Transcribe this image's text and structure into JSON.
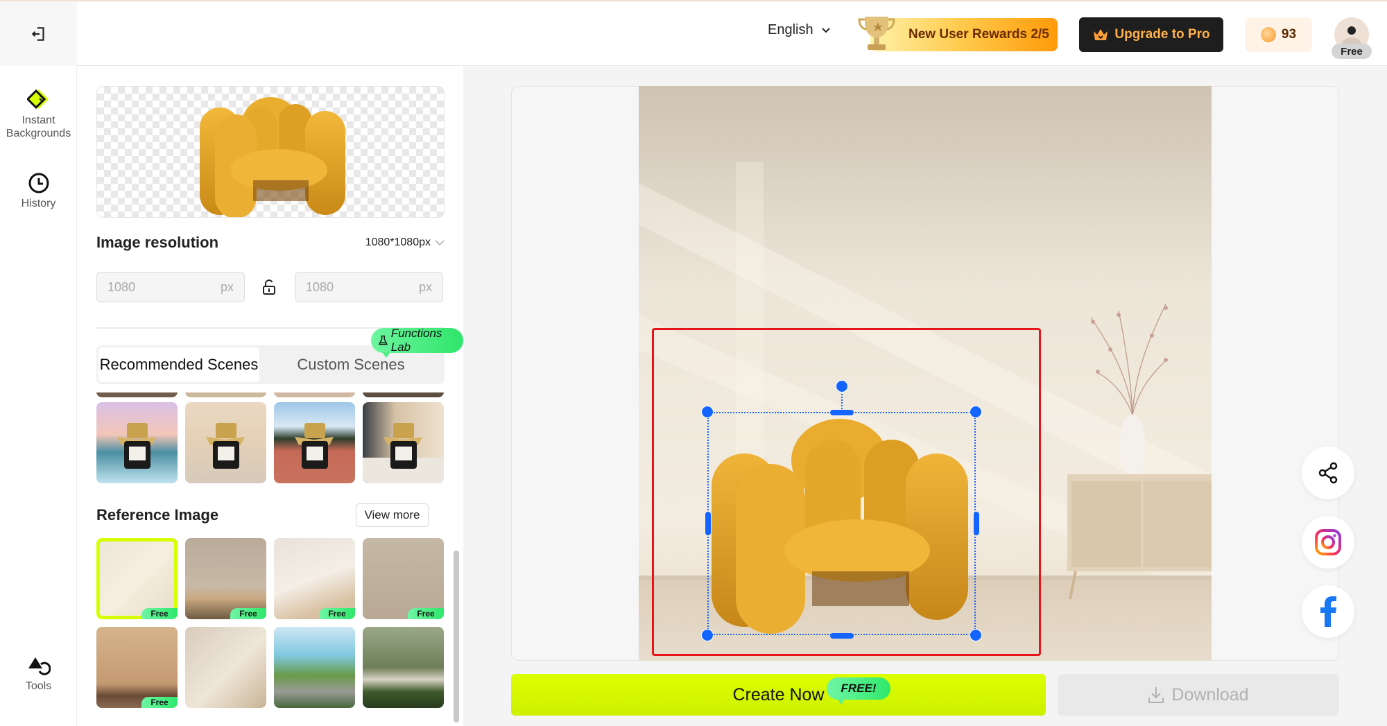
{
  "header": {
    "language": "English",
    "rewards_label": "New User Rewards 2/5",
    "upgrade_label": "Upgrade to Pro",
    "coins": "93",
    "plan_badge": "Free"
  },
  "sidebar": {
    "items": [
      {
        "label": "Instant Backgrounds",
        "icon": "instant-backgrounds-icon"
      },
      {
        "label": "History",
        "icon": "clock-icon"
      },
      {
        "label": "Tools",
        "icon": "shapes-icon"
      }
    ]
  },
  "panel": {
    "resolution_label": "Image resolution",
    "resolution_value": "1080*1080px",
    "width_placeholder": "1080",
    "height_placeholder": "1080",
    "unit": "px",
    "tabs": [
      {
        "label": "Recommended Scenes",
        "active": true
      },
      {
        "label": "Custom Scenes",
        "active": false
      }
    ],
    "lab_badge": "Functions Lab",
    "reference_title": "Reference Image",
    "view_more": "View more",
    "free_tag": "Free",
    "scene_thumbs": [
      "Perfume at sunset lake",
      "Perfume in beige hall",
      "Perfume on running track",
      "Perfume by curtains on marble"
    ],
    "reference_thumbs": [
      {
        "name": "Sunlit room with vase",
        "free": true,
        "selected": true
      },
      {
        "name": "Kitchen counter",
        "free": true,
        "selected": false
      },
      {
        "name": "Sunlit wooden table",
        "free": true,
        "selected": false
      },
      {
        "name": "Beige wall with orchid",
        "free": true,
        "selected": false
      },
      {
        "name": "Flower on rock",
        "free": true,
        "selected": false
      },
      {
        "name": "Room with floor lamp",
        "free": false,
        "selected": false
      },
      {
        "name": "Stone by the sea",
        "free": false,
        "selected": false
      },
      {
        "name": "Podium in forest",
        "free": false,
        "selected": false
      }
    ]
  },
  "actions": {
    "create_label": "Create Now",
    "create_badge": "FREE!",
    "download_label": "Download"
  },
  "colors": {
    "accent": "#d6ff00",
    "selection": "#1464ff",
    "highlight_box": "#e8141c",
    "free_badge": "#3aea74"
  }
}
